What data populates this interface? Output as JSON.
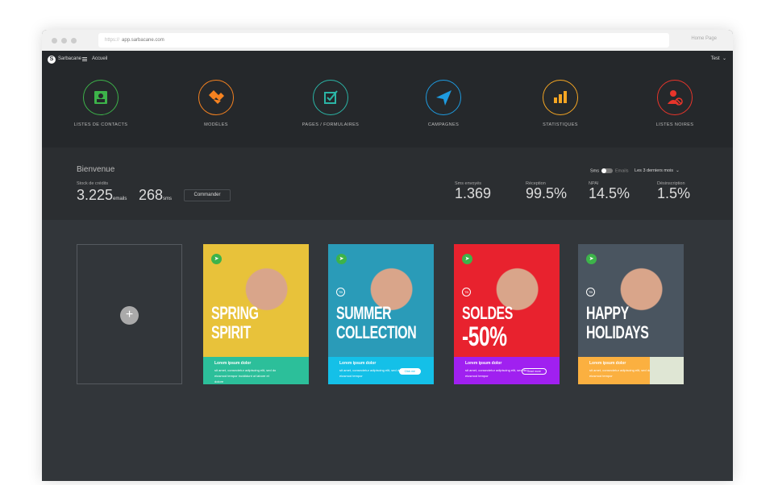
{
  "browser": {
    "url_prefix": "https://",
    "url": "app.sarbacane.com",
    "home": "Home Page"
  },
  "nav": {
    "logo": "S",
    "brand": "Sarbacane",
    "accueil": "Accueil",
    "user": "Test"
  },
  "modules": [
    {
      "label": "LISTES DE CONTACTS",
      "icon": "contacts-icon",
      "color": "#3db34a"
    },
    {
      "label": "MODÈLES",
      "icon": "templates-icon",
      "color": "#f58220"
    },
    {
      "label": "PAGES / FORMULAIRES",
      "icon": "form-check-icon",
      "color": "#2bb5a6"
    },
    {
      "label": "CAMPAGNES",
      "icon": "paper-plane-icon",
      "color": "#1e9be0"
    },
    {
      "label": "STATISTIQUES",
      "icon": "bar-chart-icon",
      "color": "#f5a623"
    },
    {
      "label": "LISTES NOIRES",
      "icon": "blocked-user-icon",
      "color": "#e8352b"
    }
  ],
  "stats": {
    "welcome": "Bienvenue",
    "stock_label": "Stock de crédits",
    "emails_value": "3.225",
    "emails_unit": "emails",
    "sms_value": "268",
    "sms_unit": "sms",
    "order": "Commander",
    "toggle_left": "Sms",
    "toggle_right": "Emails",
    "period": "Les 3 derniers mois",
    "metrics": [
      {
        "label": "Sms envoyés",
        "value": "1.369"
      },
      {
        "label": "Réception",
        "value": "99.5%"
      },
      {
        "label": "NPAI",
        "value": "14.5%"
      },
      {
        "label": "Désinscription",
        "value": "1.5%"
      }
    ]
  },
  "templates": [
    {
      "headline1": "SPRING",
      "headline2": "SPIRIT",
      "title": "Lorem ipsum dolor",
      "desc": "sit amet, consectetur adipiscing elit, sed do eiusmod tempor incididunt ut labore et dolore",
      "button": "",
      "color": "#2cbf9a",
      "img": "#e8c23a"
    },
    {
      "headline1": "SUMMER",
      "headline2": "COLLECTION",
      "title": "Lorem ipsum dolor",
      "desc": "sit amet, consectetur adipiscing elit, sed do eiusmod tempor",
      "button": "Click me",
      "color": "#14c0e8",
      "img": "#2a9bb8"
    },
    {
      "headline1": "SOLDES",
      "headline2": "-50%",
      "title": "Lorem ipsum dolor",
      "desc": "sit amet, consectetur adipiscing elit, sed do eiusmod tempor",
      "button": "Read more",
      "color": "#a020f0",
      "img": "#e8222e"
    },
    {
      "headline1": "HAPPY",
      "headline2": "HOLIDAYS",
      "title": "Lorem ipsum dolor",
      "desc": "sit amet, consectetur adipiscing elit, sed do eiusmod tempor",
      "button": "",
      "color": "#fbb040",
      "img": "#4a5560"
    }
  ]
}
